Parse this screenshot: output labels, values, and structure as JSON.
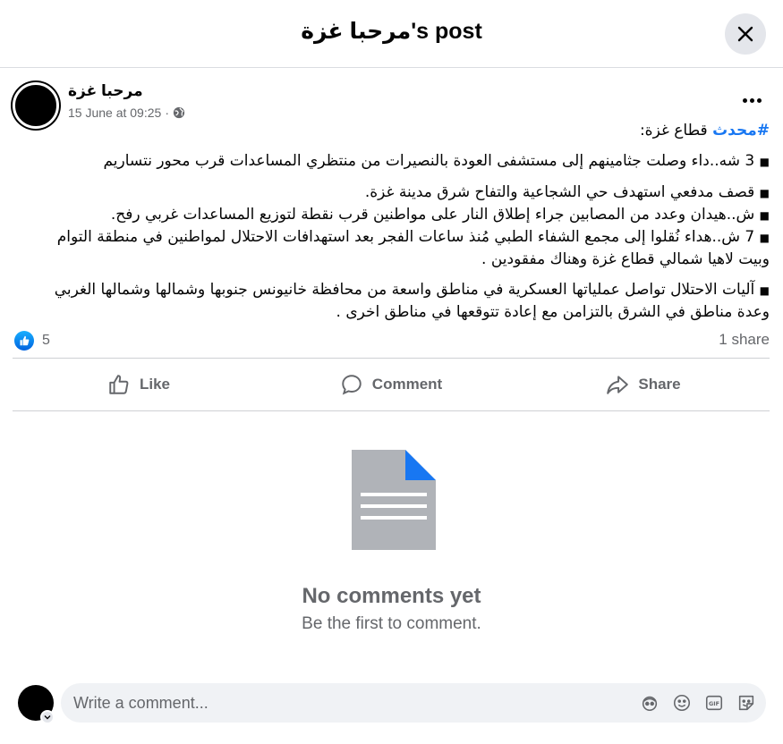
{
  "dialog": {
    "title": "مرحبا غزة's post"
  },
  "post": {
    "author": "مرحبا غزة",
    "timestamp": "15 June at 09:25",
    "audience_icon": "globe-icon",
    "hashtag": "#محدث",
    "heading": "قطاع غزة:",
    "lines": [
      "3 شه..داء وصلت جثامينهم إلى مستشفى العودة بالنصيرات من منتظري المساعدات قرب محور نتساريم",
      "قصف مدفعي استهدف حي الشجاعية والتفاح شرق مدينة غزة.",
      "ش..هيدان وعدد من المصابين جراء إطلاق النار على مواطنين قرب نقطة لتوزيع المساعدات غربي رفح.",
      "7 ش..هداء نُقلوا إلى مجمع الشفاء الطبي مُنذ ساعات الفجر بعد استهدافات الاحتلال لمواطنين في منطقة التوام وبيت لاهيا شمالي قطاع غزة وهناك مفقودين .",
      "آليات الاحتلال تواصل عملياتها العسكرية في مناطق واسعة من محافظة خانيونس جنوبها وشمالها وشمالها الغربي وعدة مناطق في الشرق بالتزامن مع إعادة تتوقعها في مناطق اخرى ."
    ]
  },
  "reactions": {
    "like_count": "5",
    "share_count": "1 share"
  },
  "actions": {
    "like": "Like",
    "comment": "Comment",
    "share": "Share"
  },
  "empty_state": {
    "title": "No comments yet",
    "subtitle": "Be the first to comment."
  },
  "composer": {
    "placeholder": "Write a comment...",
    "tools": [
      "avatar-sticker-icon",
      "emoji-icon",
      "gif-icon",
      "sticker-icon"
    ]
  },
  "colors": {
    "accent": "#1877f2",
    "muted": "#65676b",
    "divider": "#ced0d4"
  }
}
